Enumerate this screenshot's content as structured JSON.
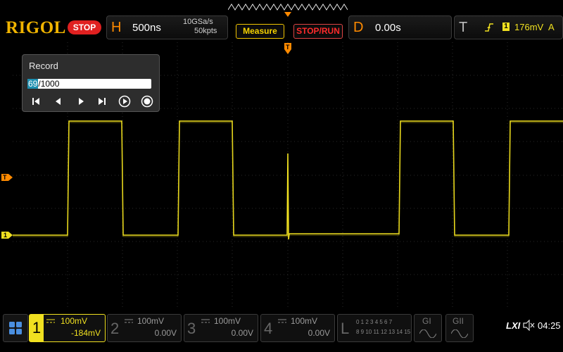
{
  "brand": "RIGOL",
  "run_state": "STOP",
  "horizontal": {
    "letter": "H",
    "timebase": "500ns",
    "sample_rate": "10GSa/s",
    "memory_depth": "50kpts"
  },
  "buttons": {
    "measure": "Measure",
    "stop_run": "STOP/RUN"
  },
  "delay": {
    "letter": "D",
    "value": "0.00s"
  },
  "trigger": {
    "letter": "T",
    "level": "176mV",
    "source": "A",
    "channel_badge": "1"
  },
  "record": {
    "title": "Record",
    "current": "69",
    "separator": "/",
    "total": "1000"
  },
  "channels": [
    {
      "num": "1",
      "scale": "100mV",
      "offset": "-184mV",
      "active": true,
      "color": "#f0e020"
    },
    {
      "num": "2",
      "scale": "100mV",
      "offset": "0.00V",
      "active": false
    },
    {
      "num": "3",
      "scale": "100mV",
      "offset": "0.00V",
      "active": false
    },
    {
      "num": "4",
      "scale": "100mV",
      "offset": "0.00V",
      "active": false
    }
  ],
  "logic": {
    "letter": "L",
    "row1": "0 1 2 3  4 5 6 7",
    "row2": "8 9 10 11 12 13 14 15"
  },
  "generators": [
    {
      "label": "GI"
    },
    {
      "label": "GII"
    }
  ],
  "status": {
    "lxi": "LXI",
    "time": "04:25"
  },
  "markers": {
    "trigger_pos": "T",
    "trigger_level": "T",
    "ch1_ground": "1"
  },
  "colors": {
    "accent": "#f0b400",
    "trace": "#f0e020",
    "stop": "#e02020",
    "marker": "#ff8a00"
  }
}
